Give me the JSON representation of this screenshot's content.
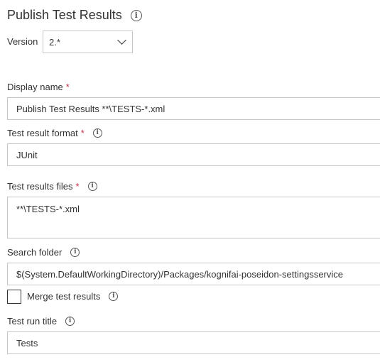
{
  "header": {
    "title": "Publish Test Results",
    "info_icon": "info-icon"
  },
  "version": {
    "label": "Version",
    "value": "2.*"
  },
  "display_name": {
    "label": "Display name",
    "required": "*",
    "value": "Publish Test Results **\\TESTS-*.xml"
  },
  "test_result_format": {
    "label": "Test result format",
    "required": "*",
    "value": "JUnit"
  },
  "test_results_files": {
    "label": "Test results files",
    "required": "*",
    "value": "**\\TESTS-*.xml"
  },
  "search_folder": {
    "label": "Search folder",
    "value": "$(System.DefaultWorkingDirectory)/Packages/kognifai-poseidon-settingsservice"
  },
  "merge_test_results": {
    "label": "Merge test results",
    "checked": false
  },
  "test_run_title": {
    "label": "Test run title",
    "value": "Tests"
  },
  "colors": {
    "required": "#c4314b",
    "border": "#c8c6c4",
    "text": "#333333"
  }
}
